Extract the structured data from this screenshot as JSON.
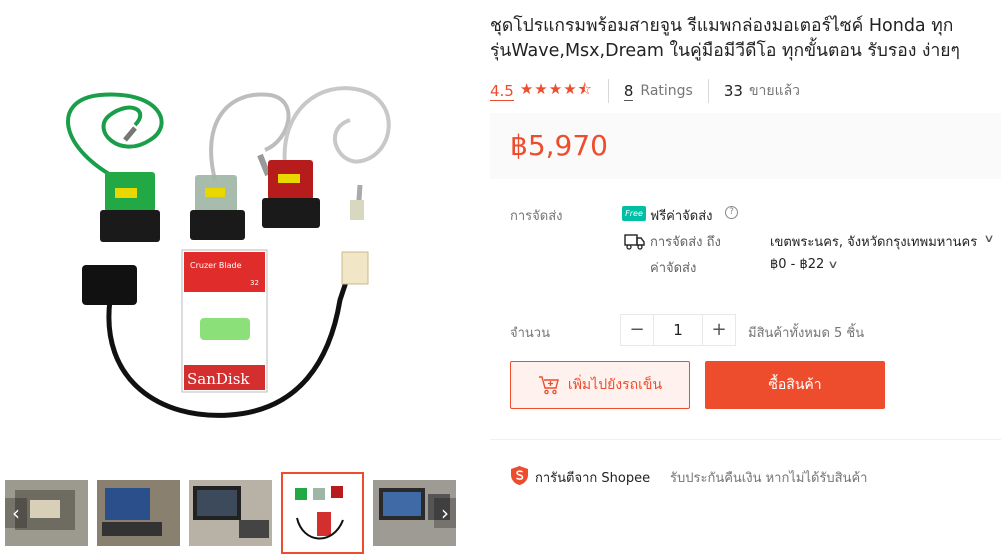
{
  "product": {
    "title": "ชุดโปรแกรมพร้อมสายจูน รีแมพกล่องมอเตอร์ไซค์ Honda ทุกรุ่นWave,Msx,Dream ในคู่มือมีวีดีโอ ทุกขั้นตอน รับรอง ง่ายๆ",
    "rating_value": "4.5",
    "rating_stars": 4.5,
    "ratings_count": "8",
    "ratings_label": "Ratings",
    "sold_count": "33",
    "sold_label": "ขายแล้ว",
    "price": "฿5,970"
  },
  "shipping": {
    "label": "การจัดส่ง",
    "free_badge": "Free",
    "free_text": "ฟรีค่าจัดส่ง",
    "help_glyph": "?",
    "ship_to_label": "การจัดส่ง ถึง",
    "ship_to_value": "เขตพระนคร, จังหวัดกรุงเทพมหานคร",
    "fee_label": "ค่าจัดส่ง",
    "fee_value": "฿0 - ฿22"
  },
  "quantity": {
    "label": "จำนวน",
    "minus": "−",
    "value": "1",
    "plus": "+",
    "stock_text": "มีสินค้าทั้งหมด 5 ชิ้น"
  },
  "actions": {
    "add_to_cart": "เพิ่มไปยังรถเข็น",
    "buy_now": "ซื้อสินค้า"
  },
  "guarantee": {
    "title": "การันตีจาก Shopee",
    "desc": "รับประกันคืนเงิน หากไม่ได้รับสินค้า"
  },
  "gallery": {
    "prev_glyph": "‹",
    "next_glyph": "›",
    "active_index": 3,
    "thumb_count": 5,
    "usb_brand": "SanDisk",
    "usb_model": "Cruzer Blade",
    "usb_capacity": "32"
  },
  "colors": {
    "accent": "#ee4d2d",
    "free_badge": "#00bfa5"
  }
}
